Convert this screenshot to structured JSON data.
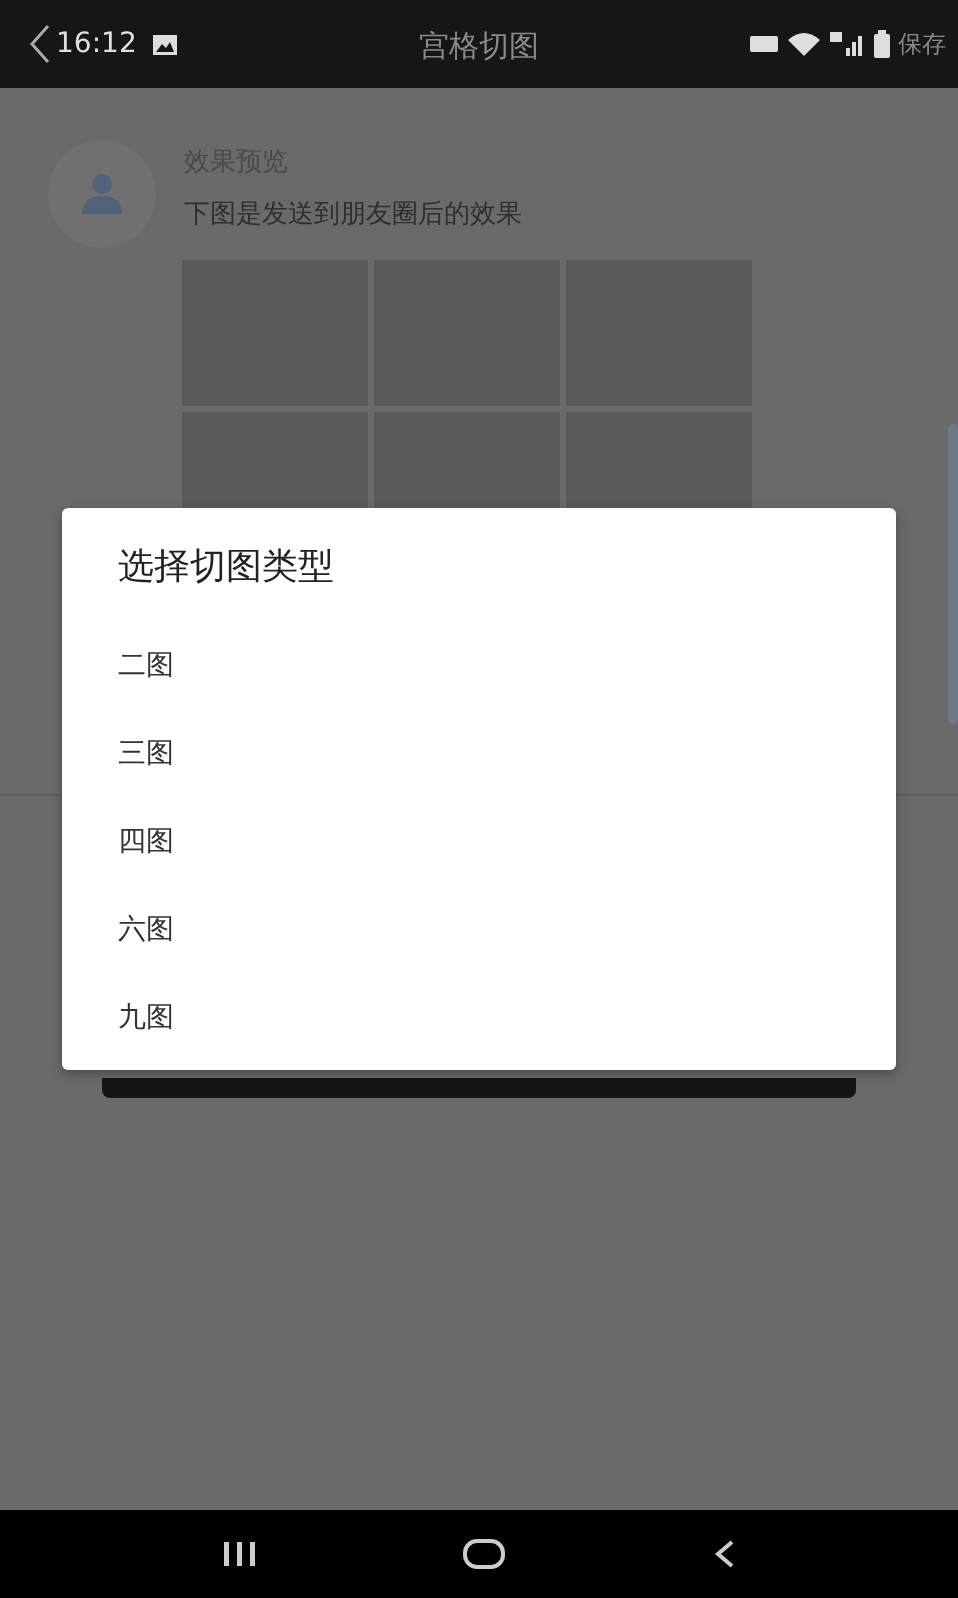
{
  "status_bar": {
    "time": "16:12"
  },
  "app_bar": {
    "title": "宫格切图",
    "action": "保存"
  },
  "preview": {
    "title": "效果预览",
    "subtitle": "下图是发送到朋友圈后的效果"
  },
  "dialog": {
    "title": "选择切图类型",
    "options": [
      {
        "label": "二图"
      },
      {
        "label": "三图"
      },
      {
        "label": "四图"
      },
      {
        "label": "六图"
      },
      {
        "label": "九图"
      }
    ]
  }
}
